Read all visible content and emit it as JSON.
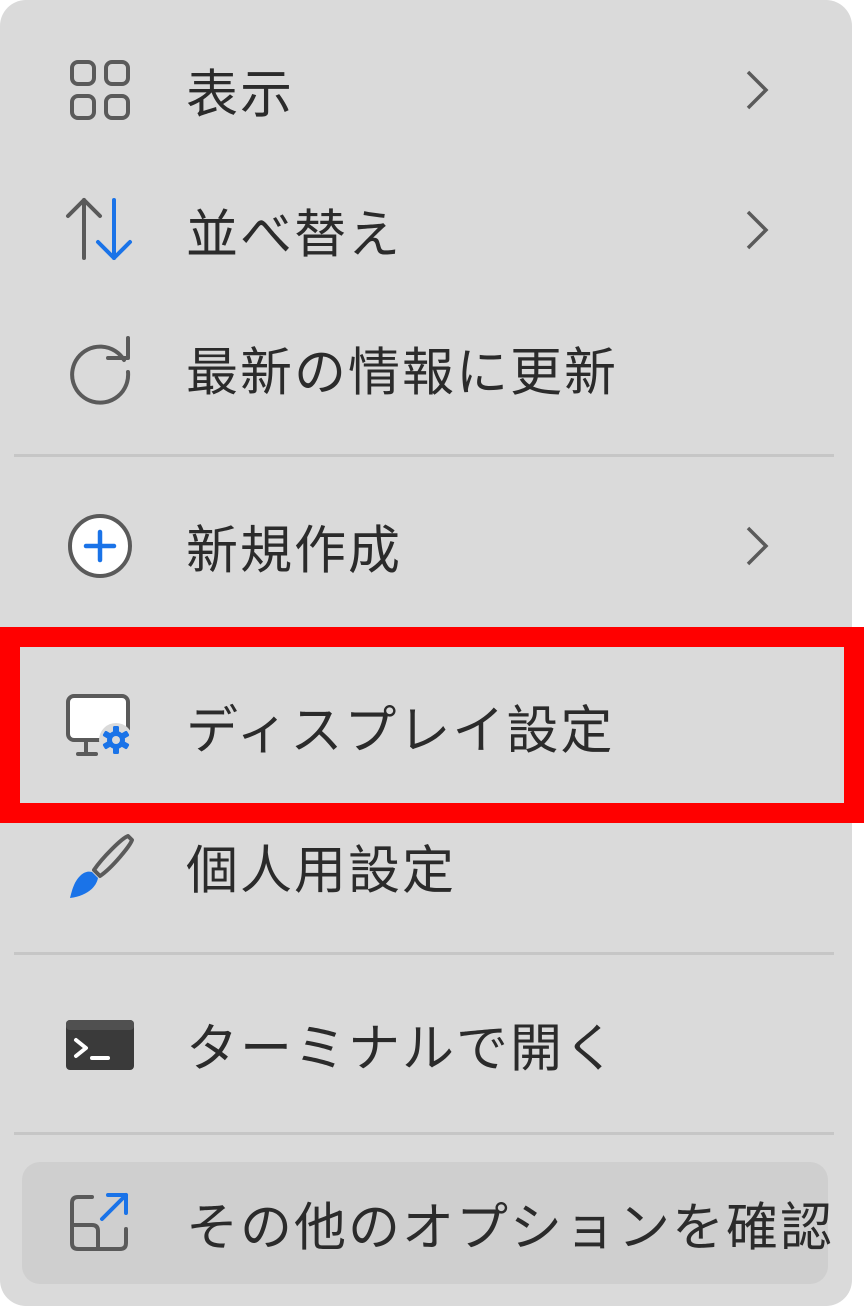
{
  "menu": {
    "items": [
      {
        "label": "表示",
        "icon": "grid-view-icon",
        "has_submenu": true
      },
      {
        "label": "並べ替え",
        "icon": "sort-arrows-icon",
        "has_submenu": true
      },
      {
        "label": "最新の情報に更新",
        "icon": "refresh-icon",
        "has_submenu": false
      },
      {
        "label": "新規作成",
        "icon": "plus-circle-icon",
        "has_submenu": true
      },
      {
        "label": "ディスプレイ設定",
        "icon": "display-settings-icon",
        "has_submenu": false,
        "highlighted": true
      },
      {
        "label": "個人用設定",
        "icon": "paintbrush-icon",
        "has_submenu": false
      },
      {
        "label": "ターミナルで開く",
        "icon": "terminal-icon",
        "has_submenu": false
      },
      {
        "label": "その他のオプションを確認",
        "icon": "more-options-icon",
        "has_submenu": false,
        "hovered": true
      }
    ]
  },
  "colors": {
    "menu_background": "#dadada",
    "text": "#2b2b2b",
    "icon_gray": "#5f5f5f",
    "accent_blue": "#1a73e8",
    "highlight_box": "#ff0000",
    "hover_background": "#cfcfcf"
  }
}
